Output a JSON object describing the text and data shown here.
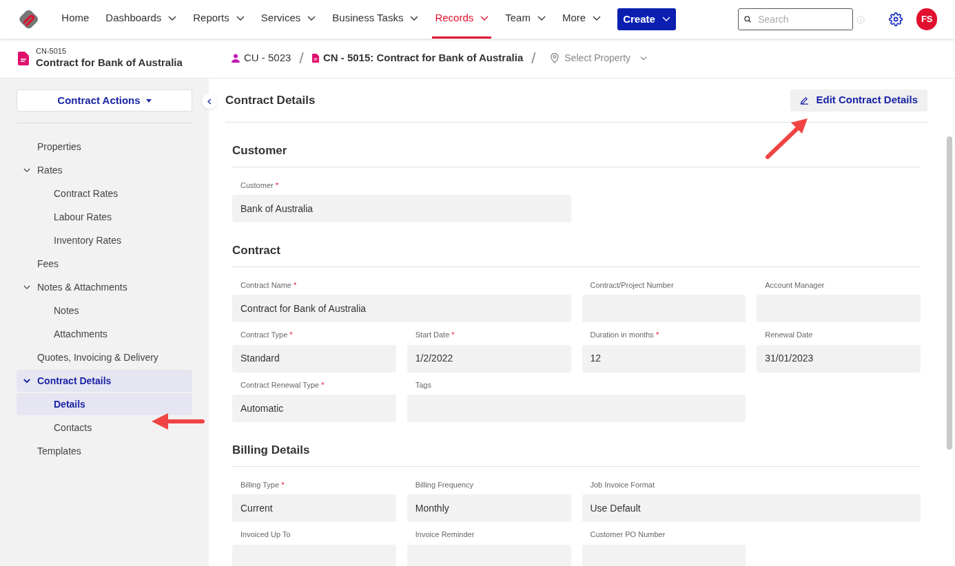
{
  "nav": {
    "items": [
      {
        "label": "Home",
        "has_menu": false,
        "selected": false
      },
      {
        "label": "Dashboards",
        "has_menu": true,
        "selected": false
      },
      {
        "label": "Reports",
        "has_menu": true,
        "selected": false
      },
      {
        "label": "Services",
        "has_menu": true,
        "selected": false
      },
      {
        "label": "Business Tasks",
        "has_menu": true,
        "selected": false
      },
      {
        "label": "Records",
        "has_menu": true,
        "selected": true
      },
      {
        "label": "Team",
        "has_menu": true,
        "selected": false
      },
      {
        "label": "More",
        "has_menu": true,
        "selected": false
      }
    ],
    "create_button": "Create",
    "search": {
      "placeholder": "Search"
    },
    "avatar": "FS"
  },
  "record": {
    "code": "CN-5015",
    "title": "Contract for Bank of Australia"
  },
  "breadcrumb": {
    "separator": "/",
    "items": [
      {
        "kind": "customer",
        "label": "CU - 5023"
      },
      {
        "kind": "contract",
        "label": "CN - 5015: Contract for Bank of Australia"
      },
      {
        "kind": "property",
        "label": "Select Property"
      }
    ]
  },
  "sidebar": {
    "actions_button": "Contract Actions",
    "items": [
      {
        "label": "Properties",
        "selected": false
      },
      {
        "label": "Rates",
        "expanded": true,
        "selected": false,
        "children": [
          {
            "label": "Contract Rates",
            "selected": false
          },
          {
            "label": "Labour Rates",
            "selected": false
          },
          {
            "label": "Inventory Rates",
            "selected": false
          }
        ]
      },
      {
        "label": "Fees",
        "selected": false
      },
      {
        "label": "Notes & Attachments",
        "expanded": true,
        "selected": false,
        "children": [
          {
            "label": "Notes",
            "selected": false
          },
          {
            "label": "Attachments",
            "selected": false
          }
        ]
      },
      {
        "label": "Quotes, Invoicing & Delivery",
        "selected": false
      },
      {
        "label": "Contract Details",
        "expanded": true,
        "selected": true,
        "children": [
          {
            "label": "Details",
            "selected": true
          },
          {
            "label": "Contacts",
            "selected": false
          }
        ]
      },
      {
        "label": "Templates",
        "selected": false
      }
    ]
  },
  "main": {
    "title": "Contract Details",
    "edit_button": "Edit Contract Details",
    "sections": [
      {
        "title": "Customer",
        "fields": [
          {
            "label": "Customer",
            "marker": "*",
            "value": "Bank of Australia",
            "kind": "wide"
          }
        ]
      },
      {
        "title": "Contract",
        "fields": [
          {
            "label": "Contract Name",
            "marker": "*",
            "value": "Contract for Bank of Australia",
            "kind": "wide"
          },
          {
            "label": "Contract/Project Number",
            "kind": "normal"
          },
          {
            "label": "Account Manager",
            "kind": "normal"
          },
          {
            "label": "Contract Type",
            "marker": "*",
            "value": "Standard",
            "kind": "normal"
          },
          {
            "label": "Start Date",
            "marker": "*",
            "value": "1/2/2022",
            "kind": "normal"
          },
          {
            "label": "Duration in months",
            "marker": "*",
            "value": "12",
            "kind": "normal"
          },
          {
            "label": "Renewal Date",
            "value": "31/01/2023",
            "kind": "normal"
          },
          {
            "label": "Contract Renewal Type",
            "marker": "*",
            "value": "Automatic",
            "kind": "normal"
          },
          {
            "label": "Tags",
            "kind": "wide"
          }
        ]
      },
      {
        "title": "Billing Details",
        "fields": [
          {
            "label": "Billing Type",
            "marker": "*",
            "value": "Current",
            "kind": "normal"
          },
          {
            "label": "Billing Frequency",
            "value": "Monthly",
            "kind": "normal"
          },
          {
            "label": "Job Invoice Format",
            "value": "Use Default",
            "kind": "wide"
          },
          {
            "label": "Invoiced Up To",
            "kind": "normal"
          },
          {
            "label": "Invoice Reminder",
            "kind": "normal"
          },
          {
            "label": "Customer PO Number",
            "kind": "normal"
          }
        ]
      }
    ]
  }
}
